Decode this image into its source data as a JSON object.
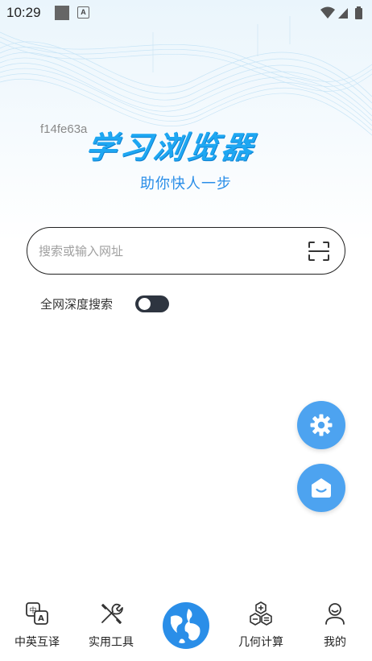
{
  "status_bar": {
    "time": "10:29",
    "app_icon_letter": "A"
  },
  "hero": {
    "hash_text": "f14fe63a",
    "app_title": "学习浏览器",
    "tagline": "助你快人一步"
  },
  "search": {
    "placeholder": "搜索或输入网址",
    "value": ""
  },
  "deep_search": {
    "label": "全网深度搜索",
    "enabled": false
  },
  "bottom_nav": {
    "items": [
      {
        "label": "中英互译",
        "icon": "translate-icon"
      },
      {
        "label": "实用工具",
        "icon": "tools-icon"
      },
      {
        "label": "",
        "icon": "globe-icon"
      },
      {
        "label": "几何计算",
        "icon": "geometry-icon"
      },
      {
        "label": "我的",
        "icon": "profile-icon"
      }
    ]
  },
  "colors": {
    "accent": "#1ea7f2",
    "fab": "#4da3f0",
    "toggle_off": "#2e3540",
    "tagline": "#2a8ee8"
  }
}
